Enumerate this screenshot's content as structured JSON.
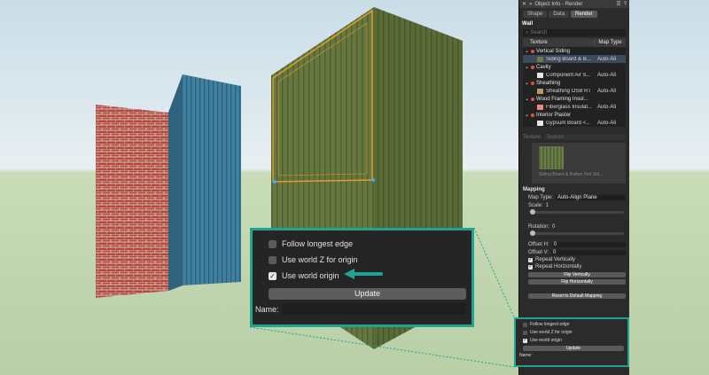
{
  "palette": {
    "title": "Object Info - Render",
    "tabs": [
      "Shape",
      "Data",
      "Render"
    ],
    "section": "Wall",
    "search_placeholder": "Search",
    "col_texture": "Texture",
    "col_map_type": "Map Type",
    "groups": [
      {
        "name": "Vertical Siding",
        "item": "Siding Board & B...",
        "map": "Auto-Ali",
        "color": "#6b7c44"
      },
      {
        "name": "Cavity",
        "item": "Component Air S...",
        "map": "Auto-Ali",
        "color": "#e6e6e6"
      },
      {
        "name": "Sheathing",
        "item": "Sheathing OSB RT",
        "map": "Auto-Ali",
        "color": "#b79b63"
      },
      {
        "name": "Wood Framing Insul...",
        "item": "Fiberglass Insulat...",
        "map": "Auto-Ali",
        "color": "#e88"
      },
      {
        "name": "Interior Plaster",
        "item": "Gypsum Board <...",
        "map": "Auto-Ali",
        "color": "#e6e6e6"
      }
    ],
    "texture_label": "Texture:",
    "texture_value": "Texture",
    "preview_caption": "Siding Board & Batten Vert Sid...",
    "mapping_header": "Mapping",
    "map_type_label": "Map Type:",
    "map_type_value": "Auto-Align Plane",
    "scale_label": "Scale:",
    "scale_value": "1",
    "rotation_label": "Rotation:",
    "rotation_value": "0",
    "offset_h_label": "Offset H:",
    "offset_h_value": "0",
    "offset_v_label": "Offset V:",
    "offset_v_value": "0",
    "repeat_h": "Repeat Vertically",
    "repeat_v": "Repeat Horizontally",
    "flip_v": "Flip Vertically",
    "flip_h": "Flip Horizontally",
    "reset": "Reset to Default Mapping"
  },
  "callout": {
    "follow_longest_edge": "Follow longest edge",
    "use_world_z": "Use world Z for origin",
    "use_world_origin": "Use world origin",
    "update": "Update",
    "name": "Name:",
    "check_mark": "✓"
  }
}
